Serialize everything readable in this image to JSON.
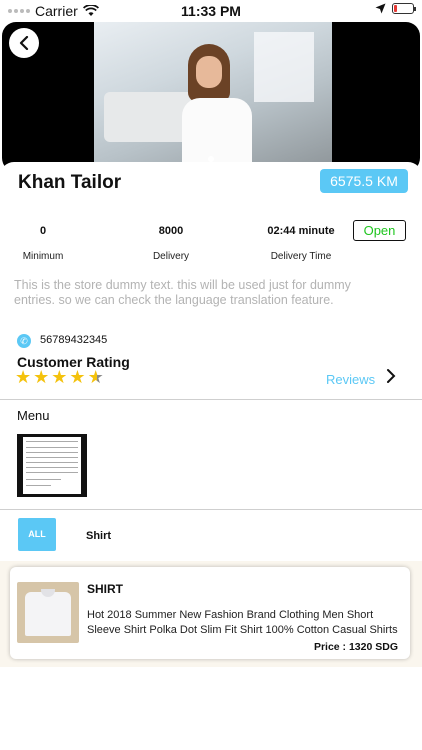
{
  "status_bar": {
    "carrier": "Carrier",
    "time": "11:33 PM",
    "battery_color": "#e53935",
    "icons": [
      "wifi-icon",
      "location-arrow-icon",
      "battery-icon"
    ]
  },
  "store": {
    "name": "Khan Tailor",
    "distance": "6575.5 KM",
    "stats": [
      {
        "value": "0",
        "label": "Minimum"
      },
      {
        "value": "8000",
        "label": "Delivery"
      },
      {
        "value": "02:44 minute",
        "label": "Delivery Time"
      }
    ],
    "open_status": "Open",
    "description": "This is the store dummy text. this will be used just for dummy entries. so we can check the language translation feature.",
    "phone": "56789432345"
  },
  "rating": {
    "title": "Customer Rating",
    "stars": 4.5,
    "reviews_label": "Reviews"
  },
  "menu": {
    "title": "Menu"
  },
  "categories": [
    {
      "label": "ALL",
      "selected": true
    },
    {
      "label": "Shirt",
      "selected": false
    }
  ],
  "products": [
    {
      "name": "SHIRT",
      "description": "Hot 2018 Summer New Fashion Brand Clothing Men Short Sleeve Shirt Polka Dot Slim Fit Shirt 100% Cotton Casual Shirts",
      "price": "Price : 1320 SDG"
    }
  ],
  "colors": {
    "accent": "#5bc8f5",
    "open": "#1ec51e",
    "star": "#f4c20d"
  }
}
